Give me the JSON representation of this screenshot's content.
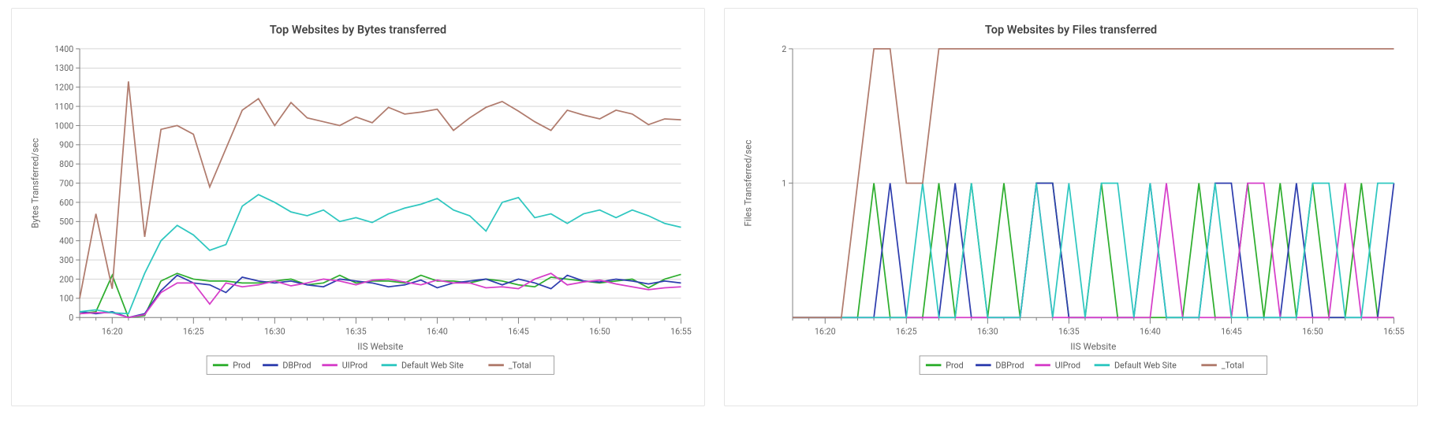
{
  "panels": [
    {
      "id": "bytes-chart",
      "title": "Top Websites by Bytes transferred"
    },
    {
      "id": "files-chart",
      "title": "Top Websites by Files transferred"
    }
  ],
  "legend_entries": [
    {
      "name": "Prod",
      "color": "#2fae2f"
    },
    {
      "name": "DBProd",
      "color": "#2f3eae"
    },
    {
      "name": "UIProd",
      "color": "#d63ec9"
    },
    {
      "name": "Default Web Site",
      "color": "#2fc7c0"
    },
    {
      "name": "_Total",
      "color": "#b07b6d"
    }
  ],
  "chart_data": [
    {
      "type": "line",
      "title": "Top Websites by Bytes transferred",
      "xlabel": "IIS Website",
      "ylabel": "Bytes Transferred/sec",
      "ylim": [
        0,
        1400
      ],
      "yticks": [
        0,
        100,
        200,
        300,
        400,
        500,
        600,
        700,
        800,
        900,
        1000,
        1100,
        1200,
        1300,
        1400
      ],
      "x_major_ticks": [
        "16:20",
        "16:25",
        "16:30",
        "16:35",
        "16:40",
        "16:45",
        "16:50",
        "16:55"
      ],
      "x_minor_per_major": 5,
      "x_labels_at_minor_index": [
        2,
        7,
        12,
        17,
        22,
        27,
        32,
        37
      ],
      "categories_minutes": [
        "16:18",
        "16:19",
        "16:20",
        "16:21",
        "16:22",
        "16:23",
        "16:24",
        "16:25",
        "16:26",
        "16:27",
        "16:28",
        "16:29",
        "16:30",
        "16:31",
        "16:32",
        "16:33",
        "16:34",
        "16:35",
        "16:36",
        "16:37",
        "16:38",
        "16:39",
        "16:40",
        "16:41",
        "16:42",
        "16:43",
        "16:44",
        "16:45",
        "16:46",
        "16:47",
        "16:48",
        "16:49",
        "16:50",
        "16:51",
        "16:52",
        "16:53",
        "16:54",
        "16:55"
      ],
      "series": [
        {
          "name": "Prod",
          "color": "#2fae2f",
          "values": [
            20,
            30,
            220,
            0,
            10,
            190,
            230,
            200,
            190,
            190,
            180,
            180,
            190,
            200,
            170,
            180,
            220,
            180,
            190,
            190,
            180,
            220,
            190,
            190,
            180,
            200,
            190,
            170,
            160,
            210,
            200,
            190,
            180,
            190,
            200,
            155,
            200,
            225
          ]
        },
        {
          "name": "DBProd",
          "color": "#2f3eae",
          "values": [
            30,
            20,
            30,
            0,
            20,
            140,
            220,
            180,
            170,
            130,
            210,
            190,
            180,
            190,
            170,
            160,
            200,
            190,
            180,
            160,
            170,
            195,
            155,
            180,
            190,
            200,
            170,
            200,
            180,
            150,
            220,
            190,
            185,
            200,
            190,
            175,
            190,
            180
          ]
        },
        {
          "name": "UIProd",
          "color": "#d63ec9",
          "values": [
            20,
            25,
            25,
            0,
            15,
            130,
            180,
            180,
            70,
            180,
            160,
            170,
            190,
            165,
            180,
            200,
            190,
            170,
            195,
            200,
            185,
            170,
            195,
            180,
            180,
            155,
            160,
            150,
            200,
            230,
            170,
            185,
            195,
            175,
            160,
            145,
            155,
            160
          ]
        },
        {
          "name": "Default Web Site",
          "color": "#2fc7c0",
          "values": [
            30,
            40,
            25,
            20,
            230,
            400,
            480,
            430,
            350,
            380,
            580,
            640,
            600,
            550,
            530,
            560,
            500,
            520,
            495,
            540,
            570,
            590,
            620,
            560,
            530,
            450,
            600,
            625,
            520,
            540,
            490,
            540,
            560,
            520,
            560,
            530,
            490,
            470
          ]
        },
        {
          "name": "_Total",
          "color": "#b07b6d",
          "values": [
            100,
            540,
            150,
            1230,
            420,
            980,
            1000,
            955,
            680,
            880,
            1080,
            1140,
            1000,
            1120,
            1040,
            1020,
            1000,
            1045,
            1015,
            1095,
            1060,
            1070,
            1085,
            975,
            1040,
            1095,
            1125,
            1075,
            1020,
            975,
            1080,
            1055,
            1035,
            1080,
            1060,
            1005,
            1035,
            1030
          ]
        }
      ],
      "legend_position": "bottom"
    },
    {
      "type": "line",
      "title": "Top Websites by Files transferred",
      "xlabel": "IIS Website",
      "ylabel": "Files Transferred/sec",
      "ylim": [
        0,
        2
      ],
      "yticks": [
        1,
        2
      ],
      "x_major_ticks": [
        "16:20",
        "16:25",
        "16:30",
        "16:35",
        "16:40",
        "16:45",
        "16:50",
        "16:55"
      ],
      "x_minor_per_major": 5,
      "x_labels_at_minor_index": [
        2,
        7,
        12,
        17,
        22,
        27,
        32,
        37
      ],
      "categories_minutes": [
        "16:18",
        "16:19",
        "16:20",
        "16:21",
        "16:22",
        "16:23",
        "16:24",
        "16:25",
        "16:26",
        "16:27",
        "16:28",
        "16:29",
        "16:30",
        "16:31",
        "16:32",
        "16:33",
        "16:34",
        "16:35",
        "16:36",
        "16:37",
        "16:38",
        "16:39",
        "16:40",
        "16:41",
        "16:42",
        "16:43",
        "16:44",
        "16:45",
        "16:46",
        "16:47",
        "16:48",
        "16:49",
        "16:50",
        "16:51",
        "16:52",
        "16:53",
        "16:54",
        "16:55"
      ],
      "series": [
        {
          "name": "Prod",
          "color": "#2fae2f",
          "values": [
            0,
            0,
            0,
            0,
            0,
            1,
            0,
            0,
            0,
            1,
            0,
            1,
            0,
            1,
            0,
            1,
            1,
            0,
            0,
            1,
            0,
            0,
            0,
            0,
            0,
            1,
            0,
            0,
            1,
            0,
            1,
            0,
            1,
            0,
            0,
            1,
            0,
            0
          ]
        },
        {
          "name": "DBProd",
          "color": "#2f3eae",
          "values": [
            0,
            0,
            0,
            0,
            0,
            0,
            1,
            0,
            0,
            0,
            1,
            0,
            0,
            0,
            0,
            1,
            1,
            0,
            0,
            0,
            0,
            0,
            1,
            0,
            0,
            0,
            1,
            1,
            0,
            0,
            0,
            1,
            0,
            0,
            0,
            0,
            0,
            1
          ]
        },
        {
          "name": "UIProd",
          "color": "#d63ec9",
          "values": [
            0,
            0,
            0,
            0,
            0,
            0,
            0,
            0,
            0,
            0,
            0,
            0,
            0,
            0,
            0,
            1,
            0,
            0,
            0,
            0,
            0,
            0,
            0,
            1,
            0,
            0,
            0,
            0,
            1,
            1,
            0,
            0,
            0,
            0,
            1,
            0,
            0,
            0
          ]
        },
        {
          "name": "Default Web Site",
          "color": "#2fc7c0",
          "values": [
            0,
            0,
            0,
            0,
            0,
            0,
            0,
            0,
            1,
            0,
            0,
            1,
            0,
            0,
            0,
            1,
            0,
            1,
            0,
            1,
            1,
            0,
            1,
            0,
            0,
            0,
            1,
            0,
            0,
            0,
            0,
            0,
            1,
            1,
            0,
            0,
            1,
            1
          ]
        },
        {
          "name": "_Total",
          "color": "#b07b6d",
          "values": [
            0,
            0,
            0,
            0,
            1,
            2,
            2,
            1,
            1,
            2,
            2,
            2,
            2,
            2,
            2,
            2,
            2,
            2,
            2,
            2,
            2,
            2,
            2,
            2,
            2,
            2,
            2,
            2,
            2,
            2,
            2,
            2,
            2,
            2,
            2,
            2,
            2,
            2
          ]
        }
      ],
      "legend_position": "bottom"
    }
  ]
}
